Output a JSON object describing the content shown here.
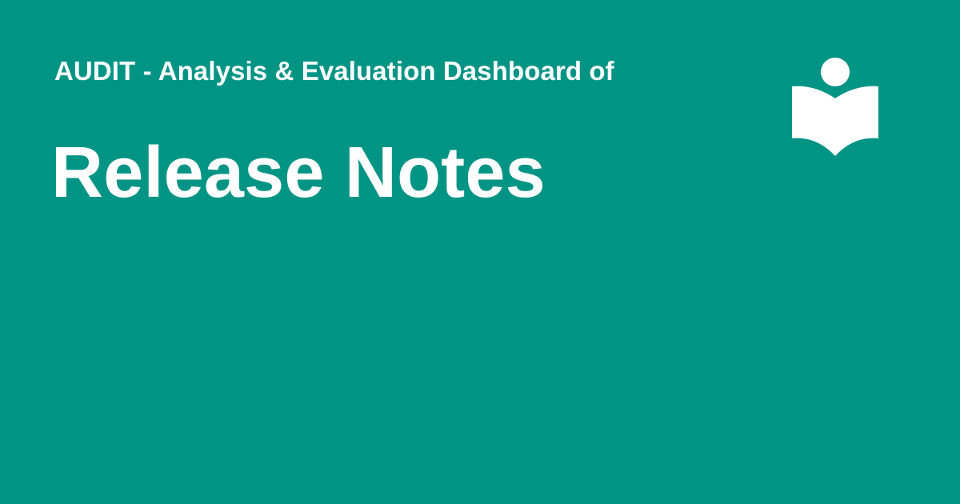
{
  "header": {
    "subtitle": "AUDIT - Analysis & Evaluation Dashboard of",
    "title": "Release Notes"
  },
  "logo": {
    "icon": "reader-book-icon"
  },
  "colors": {
    "background": "#009485",
    "foreground": "#ffffff"
  }
}
